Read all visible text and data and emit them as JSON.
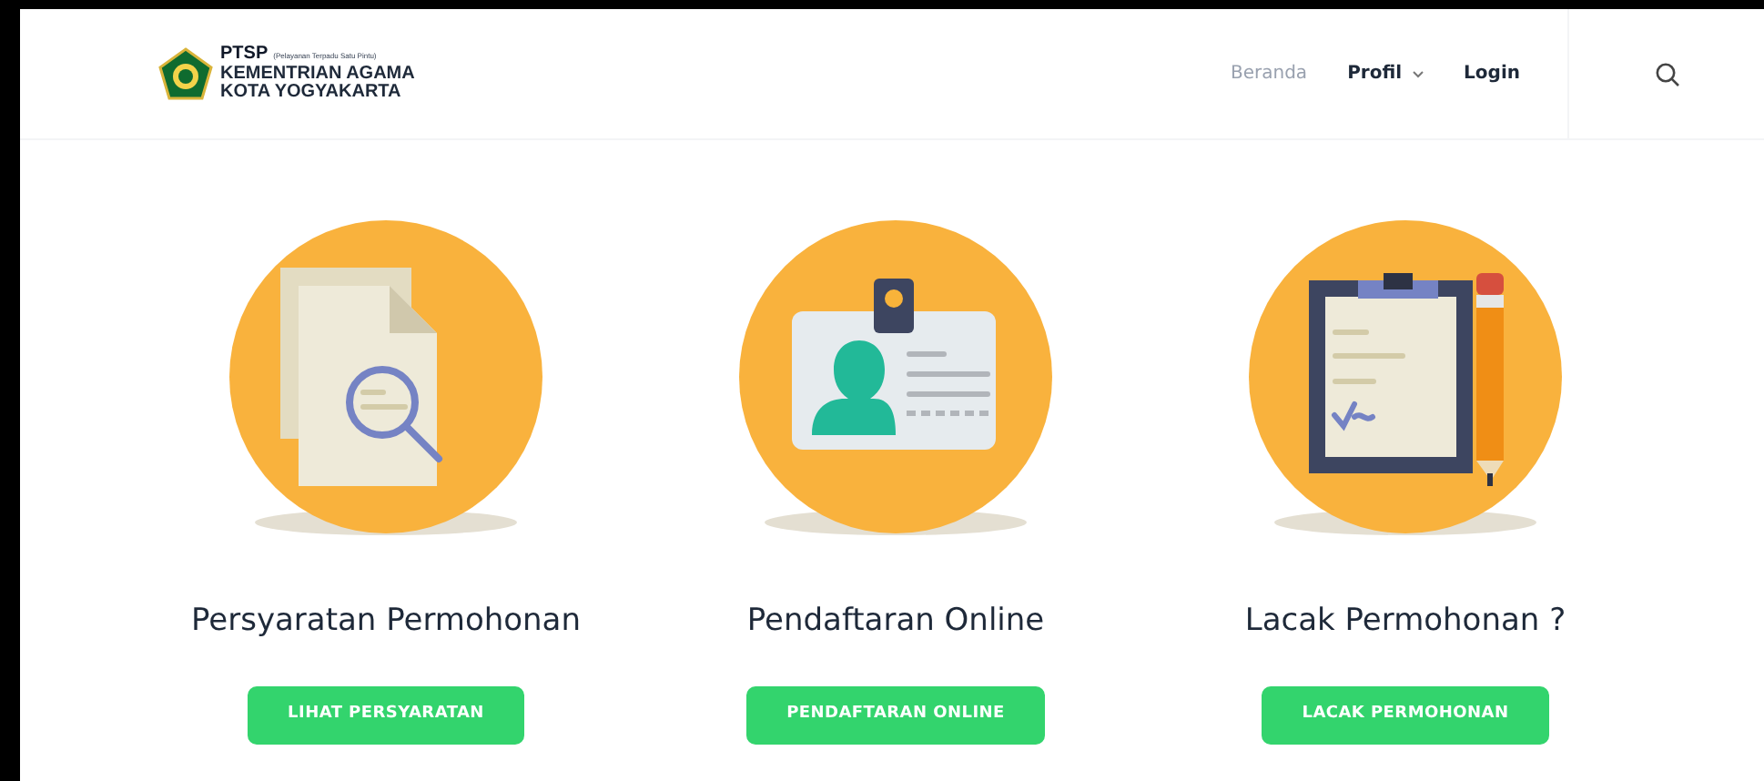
{
  "header": {
    "brand": {
      "acronym": "PTSP",
      "expansion": "(Pelayanan Terpadu Satu Pintu)",
      "line_1": "KEMENTRIAN AGAMA",
      "line_2": "KOTA YOGYAKARTA"
    },
    "nav": [
      {
        "label": "Beranda",
        "selected": true
      },
      {
        "label": "Profil",
        "selected": false,
        "dropdown": true
      },
      {
        "label": "Login",
        "selected": false
      }
    ]
  },
  "services": [
    {
      "kind": "documents",
      "title": "Persyaratan Permohonan",
      "button": "LIHAT PERSYARATAN"
    },
    {
      "kind": "id-card",
      "title": "Pendaftaran Online",
      "button": "PENDAFTARAN ONLINE"
    },
    {
      "kind": "clipboard",
      "title": "Lacak Permohonan ?",
      "button": "LACAK PERMOHONAN"
    }
  ]
}
